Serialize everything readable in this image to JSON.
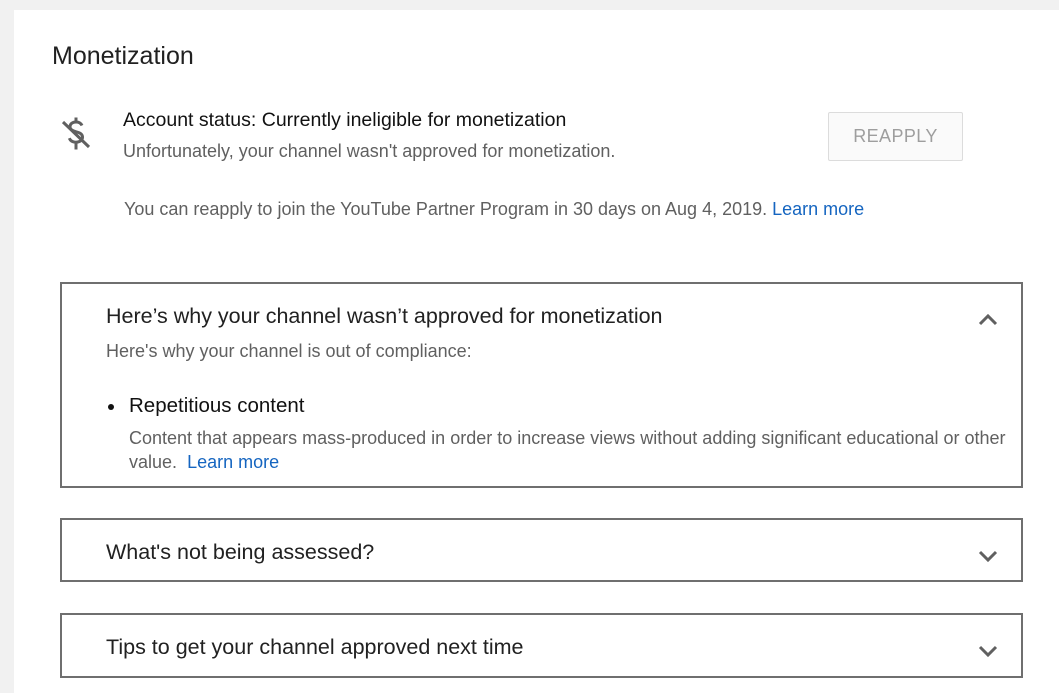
{
  "section": {
    "title": "Monetization"
  },
  "account_status": {
    "icon": "no-money-icon",
    "heading": "Account status: Currently ineligible for monetization",
    "subtext": "Unfortunately, your channel wasn't approved for monetization.",
    "reapply_button": "REAPPLY",
    "reapply_note": "You can reapply to join the YouTube Partner Program in 30 days on Aug 4, 2019.",
    "learn_more": "Learn more"
  },
  "panels": [
    {
      "title": "Here’s why your channel wasn’t approved for monetization",
      "expanded": true,
      "chevron": "chevron-up-icon",
      "intro": "Here's why your channel is out of compliance:",
      "reasons": [
        {
          "title": "Repetitious content",
          "description": "Content that appears mass-produced in order to increase views without adding significant educational or other value.",
          "learn_more": "Learn more"
        }
      ]
    },
    {
      "title": "What's not being assessed?",
      "expanded": false,
      "chevron": "chevron-down-icon"
    },
    {
      "title": "Tips to get your channel approved next time",
      "expanded": false,
      "chevron": "chevron-down-icon"
    }
  ],
  "colors": {
    "page_background": "#f1f1f1",
    "card_background": "#ffffff",
    "link": "#1565c0",
    "panel_border": "#6f6f6f",
    "secondary_text": "#606060",
    "disabled_button_text": "#9e9e9e"
  }
}
